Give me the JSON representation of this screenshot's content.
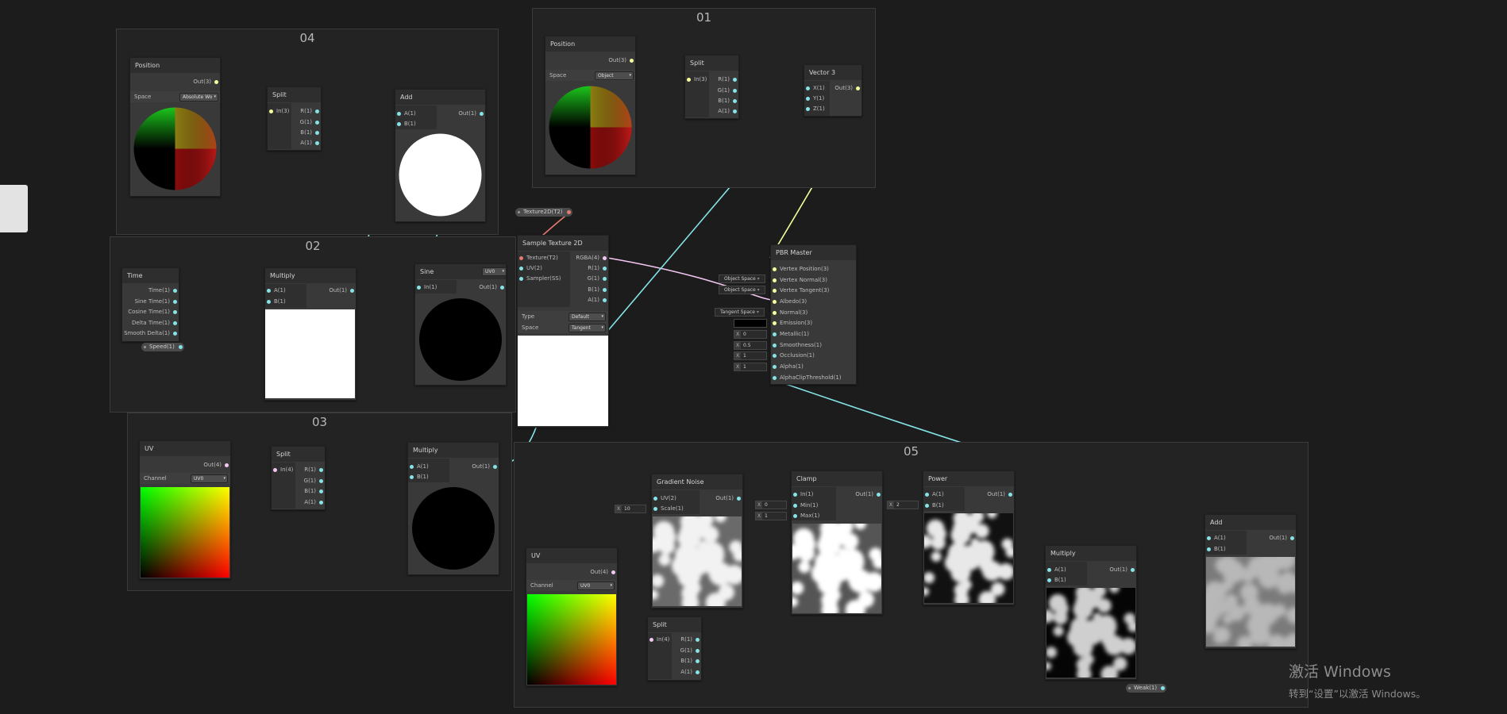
{
  "groups": [
    {
      "title": "04"
    },
    {
      "title": "01"
    },
    {
      "title": "02"
    },
    {
      "title": "03"
    },
    {
      "title": "05"
    }
  ],
  "nodes": {
    "position_04": {
      "title": "Position",
      "out": "Out(3)",
      "space_label": "Space",
      "space_value": "Absolute Wo"
    },
    "split_04": {
      "title": "Split",
      "in": "In(3)",
      "outs": [
        "R(1)",
        "G(1)",
        "B(1)",
        "A(1)"
      ]
    },
    "add_04": {
      "title": "Add",
      "ins": [
        "A(1)",
        "B(1)"
      ],
      "out": "Out(1)"
    },
    "position_01": {
      "title": "Position",
      "out": "Out(3)",
      "space_label": "Space",
      "space_value": "Object"
    },
    "split_01": {
      "title": "Split",
      "in": "In(3)",
      "outs": [
        "R(1)",
        "G(1)",
        "B(1)",
        "A(1)"
      ]
    },
    "vector3_01": {
      "title": "Vector 3",
      "ins": [
        "X(1)",
        "Y(1)",
        "Z(1)"
      ],
      "out": "Out(3)"
    },
    "time_02": {
      "title": "Time",
      "outs": [
        "Time(1)",
        "Sine Time(1)",
        "Cosine Time(1)",
        "Delta Time(1)",
        "Smooth Delta(1)"
      ]
    },
    "multiply_02": {
      "title": "Multiply",
      "ins": [
        "A(1)",
        "B(1)"
      ],
      "out": "Out(1)"
    },
    "sine": {
      "title": "Sine",
      "in": "In(1)",
      "out": "Out(1)",
      "uv_ddl": "UV0"
    },
    "sample_tex": {
      "title": "Sample Texture 2D",
      "ins": [
        "Texture(T2)",
        "UV(2)",
        "Sampler(SS)"
      ],
      "outs": [
        "RGBA(4)",
        "R(1)",
        "G(1)",
        "B(1)",
        "A(1)"
      ],
      "type_label": "Type",
      "type_value": "Default",
      "space_label": "Space",
      "space_value": "Tangent"
    },
    "pbr": {
      "title": "PBR Master",
      "ins": [
        "Vertex Position(3)",
        "Vertex Normal(3)",
        "Vertex Tangent(3)",
        "Albedo(3)",
        "Normal(3)",
        "Emission(3)",
        "Metallic(1)",
        "Smoothness(1)",
        "Occlusion(1)",
        "Alpha(1)",
        "AlphaClipThreshold(1)"
      ]
    },
    "uv_03": {
      "title": "UV",
      "out": "Out(4)",
      "channel_label": "Channel",
      "channel_value": "UV0"
    },
    "split_03": {
      "title": "Split",
      "in": "In(4)",
      "outs": [
        "R(1)",
        "G(1)",
        "B(1)",
        "A(1)"
      ]
    },
    "multiply_03": {
      "title": "Multiply",
      "ins": [
        "A(1)",
        "B(1)"
      ],
      "out": "Out(1)"
    },
    "uv_05": {
      "title": "UV",
      "out": "Out(4)",
      "channel_label": "Channel",
      "channel_value": "UV0"
    },
    "gradient_noise": {
      "title": "Gradient Noise",
      "ins": [
        "UV(2)",
        "Scale(1)"
      ],
      "out": "Out(1)"
    },
    "clamp": {
      "title": "Clamp",
      "ins": [
        "In(1)",
        "Min(1)",
        "Max(1)"
      ],
      "out": "Out(1)"
    },
    "power": {
      "title": "Power",
      "ins": [
        "A(1)",
        "B(1)"
      ],
      "out": "Out(1)"
    },
    "multiply_05": {
      "title": "Multiply",
      "ins": [
        "A(1)",
        "B(1)"
      ],
      "out": "Out(1)"
    },
    "add_05": {
      "title": "Add",
      "ins": [
        "A(1)",
        "B(1)"
      ],
      "out": "Out(1)"
    },
    "split_05": {
      "title": "Split",
      "in": "In(4)",
      "outs": [
        "R(1)",
        "G(1)",
        "B(1)",
        "A(1)"
      ]
    }
  },
  "properties": {
    "texture": "Texture2D(T2)",
    "speed": "Speed(1)",
    "weak": "Weak(1)"
  },
  "inline_values": {
    "pbr_vertex_normal_space": "Object Space",
    "pbr_vertex_tangent_space": "Object Space",
    "pbr_normal_space": "Tangent Space",
    "pbr_metallic": "0",
    "pbr_smoothness": "0.5",
    "pbr_occlusion": "1",
    "pbr_alpha": "1",
    "noise_scale": "10",
    "clamp_min": "0",
    "clamp_max": "1",
    "power_b": "2",
    "x_label": "X"
  },
  "watermark": {
    "line1": "激活 Windows",
    "line2": "转到“设置”以激活 Windows。"
  },
  "colors": {
    "background": "#1c1c1c",
    "wire_float": "#84e4e7",
    "wire_vector3": "#f6ff9a",
    "wire_vector4": "#f3c7f2",
    "wire_texture": "#e67970"
  }
}
